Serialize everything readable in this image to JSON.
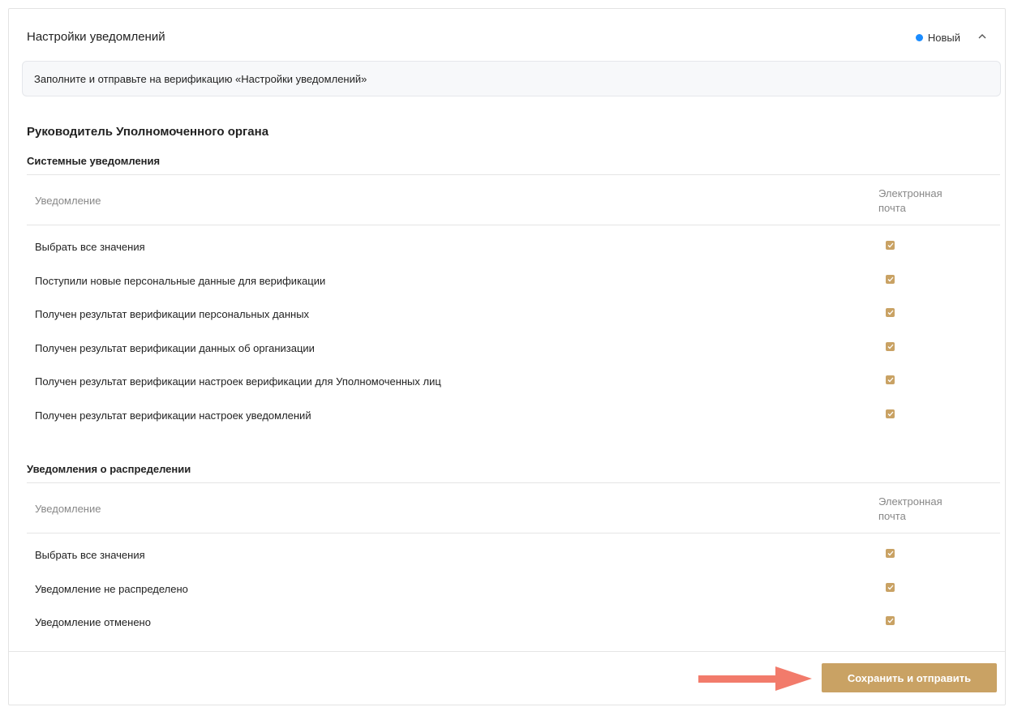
{
  "header": {
    "title": "Настройки уведомлений",
    "status_label": "Новый",
    "status_color": "#1a8cff",
    "collapse_icon": "chevron-up-icon"
  },
  "info": {
    "text": "Заполните и отправьте на верификацию «Настройки уведомлений»"
  },
  "role": {
    "title": "Руководитель Уполномоченного органа"
  },
  "sections": [
    {
      "title": "Системные уведомления",
      "col_notification": "Уведомление",
      "col_email": "Электронная почта",
      "rows": [
        {
          "label": "Выбрать все значения",
          "email_checked": true
        },
        {
          "label": "Поступили новые персональные данные для верификации",
          "email_checked": true
        },
        {
          "label": "Получен результат верификации персональных данных",
          "email_checked": true
        },
        {
          "label": "Получен результат верификации данных об организации",
          "email_checked": true
        },
        {
          "label": "Получен результат верификации настроек верификации для Уполномоченных лиц",
          "email_checked": true
        },
        {
          "label": "Получен результат верификации настроек уведомлений",
          "email_checked": true
        }
      ]
    },
    {
      "title": "Уведомления о распределении",
      "col_notification": "Уведомление",
      "col_email": "Электронная почта",
      "rows": [
        {
          "label": "Выбрать все значения",
          "email_checked": true
        },
        {
          "label": "Уведомление не распределено",
          "email_checked": true
        },
        {
          "label": "Уведомление отменено",
          "email_checked": true
        }
      ]
    }
  ],
  "footer": {
    "submit_label": "Сохранить и отправить",
    "accent_color": "#c9a264",
    "annotation_arrow_color": "#f27b6b"
  }
}
